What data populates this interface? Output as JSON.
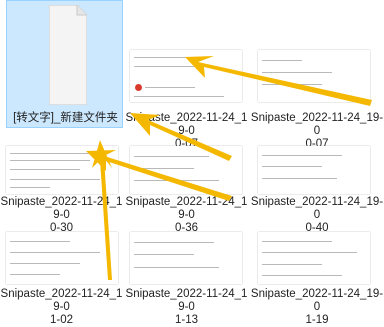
{
  "files": [
    {
      "name": "[转文字]_新建文件夹"
    },
    {
      "name": "Snipaste_2022-11-24_19-0",
      "name2": "0-07"
    },
    {
      "name": "Snipaste_2022-11-24_19-0",
      "name2": "0-07"
    },
    {
      "name": "Snipaste_2022-11-24_19-0",
      "name2": "0-30"
    },
    {
      "name": "Snipaste_2022-11-24_19-0",
      "name2": "0-36"
    },
    {
      "name": "Snipaste_2022-11-24_19-0",
      "name2": "0-40"
    },
    {
      "name": "Snipaste_2022-11-24_19-0",
      "name2": "1-02"
    },
    {
      "name": "Snipaste_2022-11-24_19-0",
      "name2": "1-13"
    },
    {
      "name": "Snipaste_2022-11-24_19-0",
      "name2": "1-19"
    }
  ],
  "colors": {
    "arrow": "#f5b800",
    "selection": "#cce8ff"
  }
}
